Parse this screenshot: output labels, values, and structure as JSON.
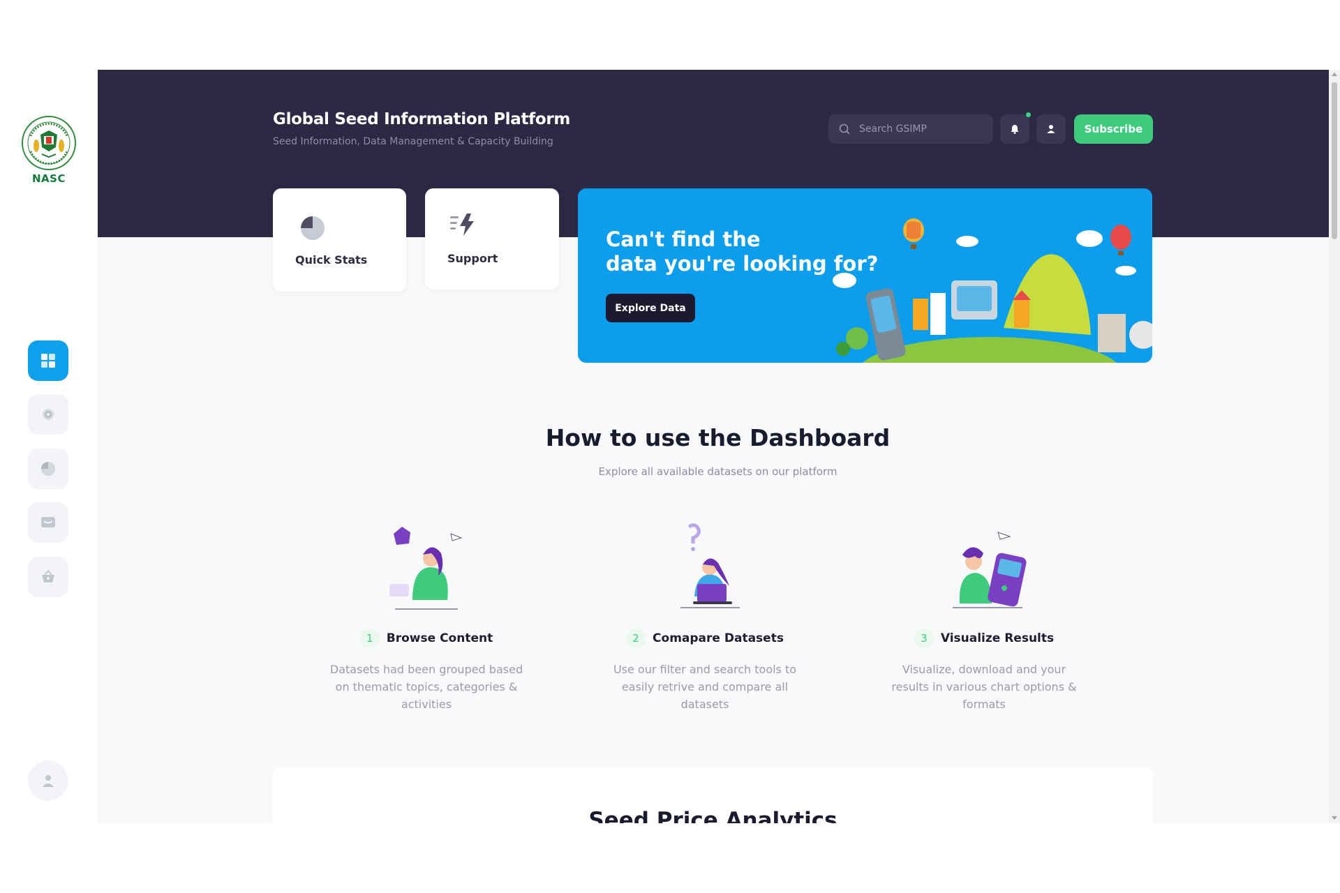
{
  "logo": {
    "text": "NASC"
  },
  "sidebar": {
    "items": [
      {
        "name": "dashboard",
        "icon": "dashboard-icon",
        "active": true
      },
      {
        "name": "settings",
        "icon": "gear-icon",
        "active": false
      },
      {
        "name": "stats",
        "icon": "pie-chart-icon",
        "active": false
      },
      {
        "name": "messages",
        "icon": "message-icon",
        "active": false
      },
      {
        "name": "basket",
        "icon": "basket-icon",
        "active": false
      }
    ],
    "profile_icon": "user-icon"
  },
  "header": {
    "title": "Global Seed Information Platform",
    "subtitle": "Seed Information, Data Management & Capacity Building",
    "search_placeholder": "Search GSIMP",
    "subscribe_label": "Subscribe"
  },
  "cards": [
    {
      "label": "Quick Stats",
      "icon": "pie-chart-icon"
    },
    {
      "label": "Support",
      "icon": "lightning-icon"
    }
  ],
  "banner": {
    "title_line1": "Can't find the",
    "title_line2": "data you're looking for?",
    "button_label": "Explore Data"
  },
  "how_to": {
    "title": "How to use the Dashboard",
    "subtitle": "Explore all available datasets on our platform",
    "steps": [
      {
        "number": "1",
        "title": "Browse Content",
        "description": "Datasets had been grouped based on thematic topics, categories & activities"
      },
      {
        "number": "2",
        "title": "Comapare Datasets",
        "description": "Use our filter and search tools to easily retrive and compare all datasets"
      },
      {
        "number": "3",
        "title": "Visualize Results",
        "description": "Visualize, download and your results in various chart options & formats"
      }
    ]
  },
  "analytics": {
    "title": "Seed Price Analytics"
  },
  "colors": {
    "hero": "#2c2945",
    "accent_blue": "#0d9ded",
    "accent_green": "#3fcb7d"
  }
}
